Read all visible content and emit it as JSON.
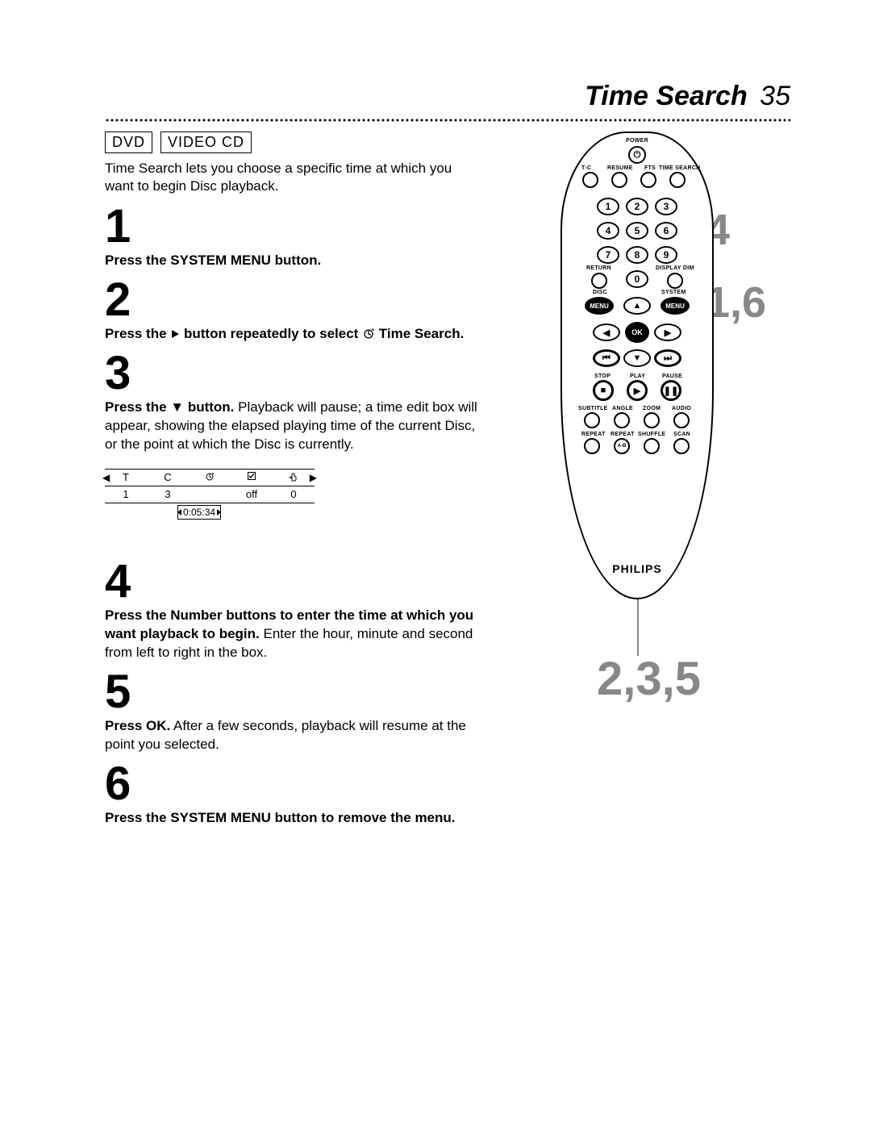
{
  "header": {
    "title": "Time Search",
    "page_number": "35"
  },
  "tags": {
    "dvd": "DVD",
    "vcd": "VIDEO CD"
  },
  "intro": "Time Search lets you choose a specific time at which you want to begin Disc playback.",
  "steps": {
    "s1": {
      "num": "1",
      "text_bold": "Press the SYSTEM MENU button."
    },
    "s2": {
      "num": "2",
      "lead": "Press the ",
      "mid": " button repeatedly to select ",
      "tail": " Time Search."
    },
    "s3": {
      "num": "3",
      "bold": "Press the ▼ button.",
      "rest": " Playback will pause; a time edit box will appear, showing the elapsed playing time of the current Disc, or the point at which the Disc is currently."
    },
    "s4": {
      "num": "4",
      "bold": "Press the Number buttons to enter the time at which you want playback to begin.",
      "rest": " Enter the hour, minute and second from left to right in the box."
    },
    "s5": {
      "num": "5",
      "bold": "Press OK.",
      "rest": " After a few seconds, playback will resume at the point you selected."
    },
    "s6": {
      "num": "6",
      "text_bold": "Press the SYSTEM MENU button to remove the menu."
    }
  },
  "osd": {
    "headers": [
      "T",
      "C",
      "clock",
      "check",
      "hand"
    ],
    "values": [
      "1",
      "3",
      "",
      "off",
      "0"
    ],
    "time": "0:05:34"
  },
  "remote": {
    "brand": "PHILIPS",
    "labels": {
      "power": "POWER",
      "tc": "T-C",
      "resume": "RESUME",
      "fts": "FTS",
      "timesearch": "TIME SEARCH",
      "return": "RETURN",
      "display_dim": "DISPLAY DIM",
      "disc": "DISC",
      "system": "SYSTEM",
      "menu": "MENU",
      "ok": "OK",
      "stop": "STOP",
      "play": "PLAY",
      "pause": "PAUSE",
      "subtitle": "SUBTITLE",
      "angle": "ANGLE",
      "zoom": "ZOOM",
      "audio": "AUDIO",
      "repeat": "REPEAT",
      "repeat_ab": "REPEAT",
      "ab": "A-B",
      "shuffle": "SHUFFLE",
      "scan": "SCAN"
    },
    "numbers": [
      "1",
      "2",
      "3",
      "4",
      "5",
      "6",
      "7",
      "8",
      "9",
      "0"
    ]
  },
  "callouts": {
    "c4": "4",
    "c16": "1,6",
    "c235": "2,3,5"
  }
}
